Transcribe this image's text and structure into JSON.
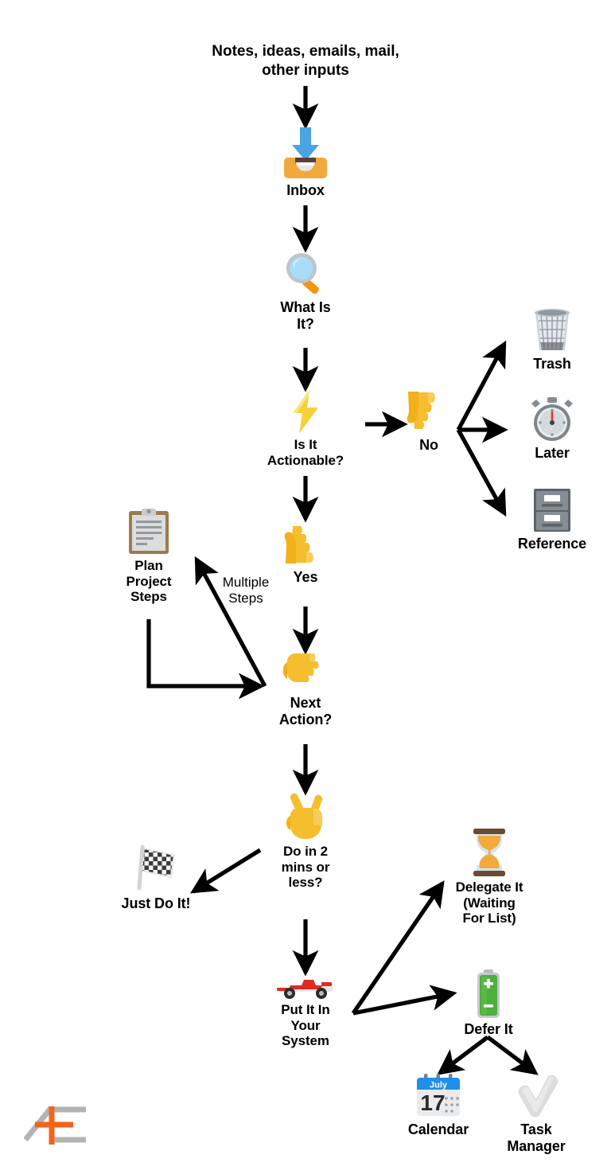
{
  "diagram": {
    "title_text": "Notes, ideas, emails, mail,\nother inputs",
    "colors": {
      "arrow": "#000000",
      "text": "#000000",
      "background": "#ffffff",
      "inbox_tray": "#F2A93B",
      "inbox_arrow": "#4BA3E3",
      "lightning": "#F7D03C",
      "hand_yellow": "#F5BE2E",
      "battery_green": "#4CAF3E",
      "hourglass_sand": "#F3A93C",
      "stopwatch_hand": "#E8342A",
      "calendar_header": "#1F8FE8",
      "logo_orange": "#F2641A",
      "logo_grey": "#B3B3B3",
      "car_red": "#E02B23",
      "trash_grey": "#C6CBD0",
      "cabinet_grey": "#7A7F85",
      "check_grey": "#D8D8D8"
    },
    "nodes": [
      {
        "id": "inbox",
        "icon": "inbox-tray-icon",
        "label": "Inbox"
      },
      {
        "id": "what-is-it",
        "icon": "magnifying-glass-icon",
        "label": "What Is\nIt?"
      },
      {
        "id": "actionable",
        "icon": "lightning-bolt-icon",
        "label": "Is It\nActionable?"
      },
      {
        "id": "no",
        "icon": "thumbs-down-icon",
        "label": "No"
      },
      {
        "id": "trash",
        "icon": "wastebasket-icon",
        "label": "Trash"
      },
      {
        "id": "later",
        "icon": "stopwatch-icon",
        "label": "Later"
      },
      {
        "id": "reference",
        "icon": "file-cabinet-icon",
        "label": "Reference"
      },
      {
        "id": "yes",
        "icon": "thumbs-up-icon",
        "label": "Yes"
      },
      {
        "id": "plan-project",
        "icon": "clipboard-icon",
        "label": "Plan\nProject\nSteps"
      },
      {
        "id": "next-action",
        "icon": "pointing-right-icon",
        "label": "Next\nAction?"
      },
      {
        "id": "two-minutes",
        "icon": "victory-hand-icon",
        "label": "Do in 2\nmins or\nless?"
      },
      {
        "id": "just-do-it",
        "icon": "chequered-flag-icon",
        "label": "Just Do It!"
      },
      {
        "id": "put-in-system",
        "icon": "racing-car-icon",
        "label": "Put It In\nYour\nSystem"
      },
      {
        "id": "delegate",
        "icon": "hourglass-icon",
        "label": "Delegate It\n(Waiting\nFor List)"
      },
      {
        "id": "defer",
        "icon": "battery-icon",
        "label": "Defer It"
      },
      {
        "id": "calendar",
        "icon": "calendar-icon",
        "label": "Calendar"
      },
      {
        "id": "task-manager",
        "icon": "check-mark-icon",
        "label": "Task\nManager"
      }
    ],
    "edge_labels": [
      {
        "id": "multiple-steps",
        "text": "Multiple\nSteps"
      }
    ],
    "calendar_icon": {
      "month": "July",
      "day": "17"
    },
    "logo": {
      "name": "asian-efficiency-logo"
    }
  }
}
